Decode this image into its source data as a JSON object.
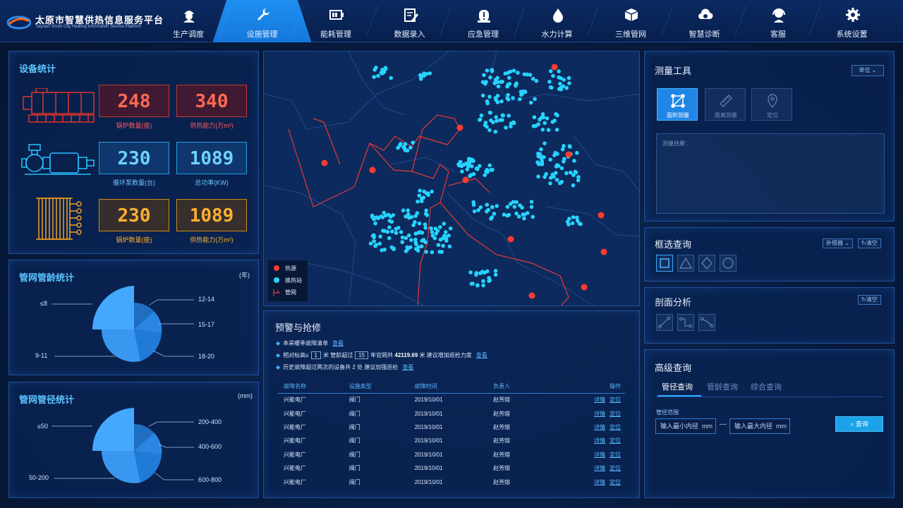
{
  "header": {
    "title": "太原市智慧供热信息服务平台",
    "subtitle": "Taiyuan Smart City Heating Information Service Platform",
    "nav": [
      {
        "label": "生产调度",
        "icon": "worker-helmet-icon"
      },
      {
        "label": "设施管理",
        "icon": "wrench-icon",
        "active": true
      },
      {
        "label": "能耗管理",
        "icon": "battery-icon"
      },
      {
        "label": "数据录入",
        "icon": "edit-document-icon"
      },
      {
        "label": "应急管理",
        "icon": "alert-icon"
      },
      {
        "label": "水力计算",
        "icon": "water-drop-icon"
      },
      {
        "label": "三维管网",
        "icon": "cube-icon"
      },
      {
        "label": "智慧诊断",
        "icon": "cloud-gear-icon"
      },
      {
        "label": "客服",
        "icon": "headset-icon"
      },
      {
        "label": "系统设置",
        "icon": "gear-icon"
      }
    ]
  },
  "equipment": {
    "title": "设备统计",
    "rows": [
      {
        "icon": "boiler-icon",
        "a": {
          "value": "248",
          "label": "锅炉数量(座)"
        },
        "b": {
          "value": "340",
          "label": "供热能力(万m²)"
        }
      },
      {
        "icon": "pump-icon",
        "a": {
          "value": "230",
          "label": "循环泵数量(台)"
        },
        "b": {
          "value": "1089",
          "label": "总功率(KW)"
        }
      },
      {
        "icon": "heat-exchanger-icon",
        "a": {
          "value": "230",
          "label": "锅炉数量(座)"
        },
        "b": {
          "value": "1089",
          "label": "供热能力(万m²)"
        }
      }
    ]
  },
  "pipe_age": {
    "title": "管网管龄统计",
    "unit": "(年)",
    "labels": [
      "≤8",
      "12-14",
      "15-17",
      "18-20",
      "9-11"
    ]
  },
  "pipe_diameter": {
    "title": "管网管径统计",
    "unit": "(mm)",
    "labels": [
      "≤50",
      "200-400",
      "400-600",
      "600-800",
      "50-200"
    ]
  },
  "map": {
    "legend": [
      "热源",
      "换热站",
      "管网"
    ],
    "colors": {
      "heat_source": "#ff3b2f",
      "station": "#27d3ff",
      "pipe": "#e53935"
    }
  },
  "warning": {
    "title": "预警与抢修",
    "line1": {
      "text": "本采暖季故障清单",
      "link": "查看"
    },
    "line2": {
      "pre": "相对标高≤",
      "v1": "1",
      "mid1": "米 管龄超过",
      "v2": "15",
      "mid2": "年官网共",
      "total": "42119.69",
      "post": "米  建议增加巡检力度",
      "link": "查看"
    },
    "line3": {
      "pre": "历史故障超过两次的设备共",
      "count": "2",
      "post": "处   建议加强巡检",
      "link": "查看"
    },
    "columns": [
      "故障名称",
      "设施类型",
      "故障时间",
      "负责人",
      "操作"
    ],
    "rows": [
      [
        "兴能电厂",
        "阀门",
        "2019/10/01",
        "赵芳熔"
      ],
      [
        "兴能电厂",
        "阀门",
        "2019/10/01",
        "赵芳熔"
      ],
      [
        "兴能电厂",
        "阀门",
        "2019/10/01",
        "赵芳熔"
      ],
      [
        "兴能电厂",
        "阀门",
        "2019/10/01",
        "赵芳熔"
      ],
      [
        "兴能电厂",
        "阀门",
        "2019/10/01",
        "赵芳熔"
      ],
      [
        "兴能电厂",
        "阀门",
        "2019/10/01",
        "赵芳熔"
      ],
      [
        "兴能电厂",
        "阀门",
        "2019/10/01",
        "赵芳熔"
      ]
    ],
    "op_detail": "详情",
    "op_locate": "定位"
  },
  "measure": {
    "title": "测量工具",
    "unit_select": "单位",
    "tools": [
      "面积测量",
      "距离测量",
      "定位"
    ],
    "result_placeholder": "测量结果："
  },
  "box_query": {
    "title": "框选查询",
    "btn1": "补偿器",
    "btn2": "清空"
  },
  "section": {
    "title": "剖面分析",
    "btn": "清空"
  },
  "advanced": {
    "title": "高级查询",
    "tabs": [
      "管径查询",
      "管龄查询",
      "综合查询"
    ],
    "range_label": "管径范围",
    "min_placeholder": "输入最小内径",
    "max_placeholder": "输入最大内径",
    "unit": "mm",
    "sep": "—",
    "query": "查询"
  }
}
